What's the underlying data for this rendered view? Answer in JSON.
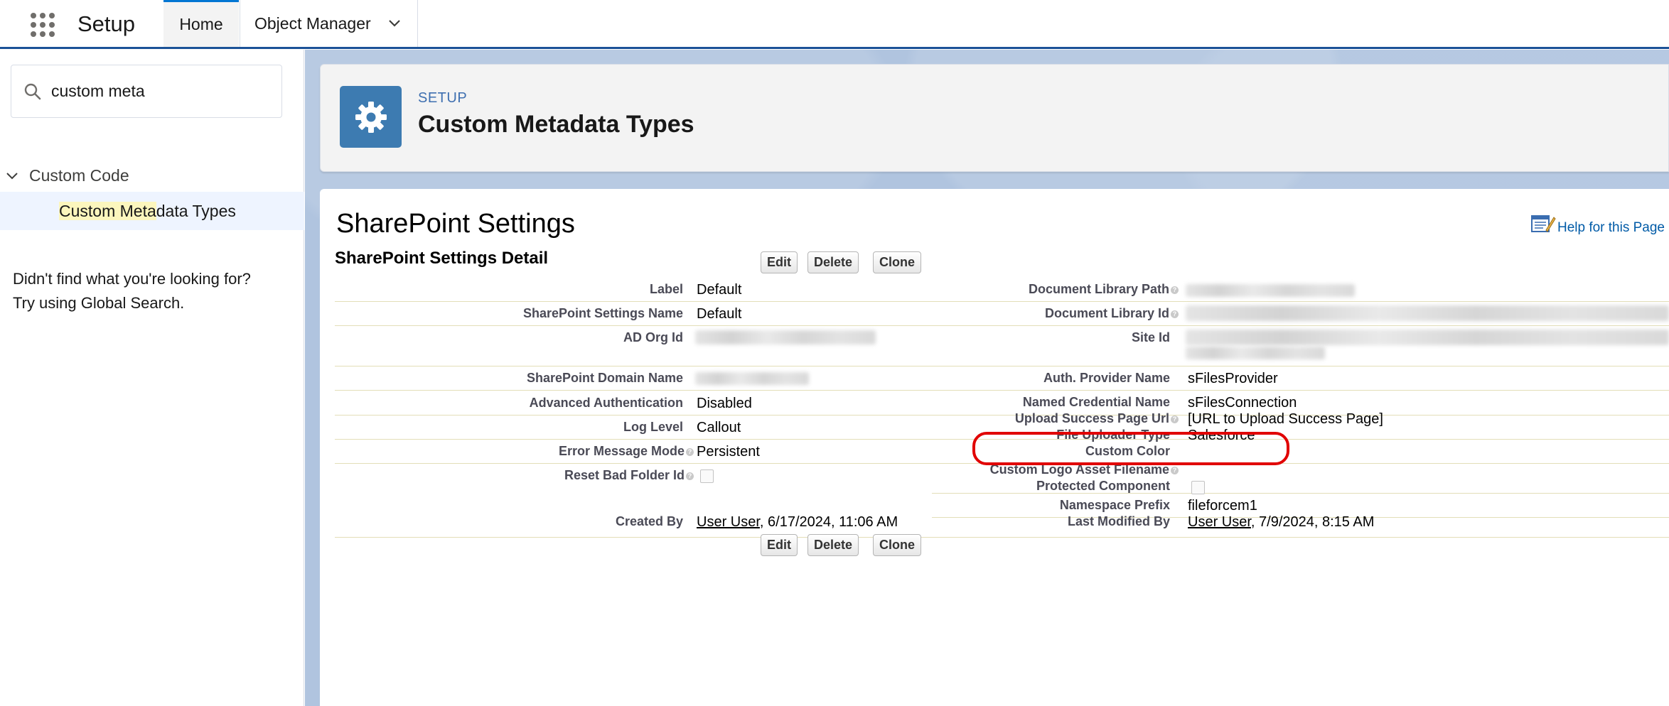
{
  "topbar": {
    "app_name": "Setup",
    "tabs": [
      {
        "label": "Home"
      },
      {
        "label": "Object Manager"
      }
    ]
  },
  "sidebar": {
    "search": {
      "value": "custom meta"
    },
    "tree": {
      "node_label": "Custom Code",
      "leaf_label_highlight": "Custom Meta",
      "leaf_label_rest": "data Types"
    },
    "not_found": {
      "line1": "Didn't find what you're looking for?",
      "line2": "Try using Global Search."
    }
  },
  "header": {
    "crumb": "SETUP",
    "title": "Custom Metadata Types"
  },
  "record": {
    "title": "SharePoint Settings",
    "help_link": "Help for this Page",
    "detail_title": "SharePoint Settings Detail",
    "buttons": {
      "edit": "Edit",
      "delete": "Delete",
      "clone": "Clone"
    },
    "left_fields": [
      {
        "label": "Label",
        "value": "Default"
      },
      {
        "label": "SharePoint Settings Name",
        "value": "Default"
      },
      {
        "label": "AD Org Id",
        "value": ""
      },
      {
        "label": "SharePoint Domain Name",
        "value": ""
      },
      {
        "label": "Advanced Authentication",
        "value": "Disabled"
      },
      {
        "label": "Log Level",
        "value": "Callout"
      },
      {
        "label": "Error Message Mode",
        "value": "Persistent"
      },
      {
        "label": "Reset Bad Folder Id",
        "value": ""
      }
    ],
    "right_fields": [
      {
        "label": "Document Library Path",
        "value": ""
      },
      {
        "label": "Document Library Id",
        "value": ""
      },
      {
        "label": "Site Id",
        "value": ""
      },
      {
        "label": "Auth. Provider Name",
        "value": "sFilesProvider"
      },
      {
        "label": "Named Credential Name",
        "value": "sFilesConnection"
      },
      {
        "label": "Upload Success Page Url",
        "value": "[URL to Upload Success Page]"
      },
      {
        "label": "File Uploader Type",
        "value": "Salesforce"
      },
      {
        "label": "Custom Color",
        "value": ""
      },
      {
        "label": "Custom Logo Asset Filename",
        "value": ""
      },
      {
        "label": "Protected Component",
        "value": ""
      },
      {
        "label": "Namespace Prefix",
        "value": "fileforcem1"
      }
    ],
    "created_by": {
      "label": "Created By",
      "user": "User User",
      "date": ", 6/17/2024, 11:06 AM"
    },
    "modified_by": {
      "label": "Last Modified By",
      "user": "User User",
      "date": ", 7/9/2024, 8:15 AM"
    }
  },
  "colors": {
    "brand_blue": "#1b5297",
    "gear_tile": "#3d7bb1",
    "highlight": "#fcf6bd",
    "annotation_red": "#e10000"
  }
}
